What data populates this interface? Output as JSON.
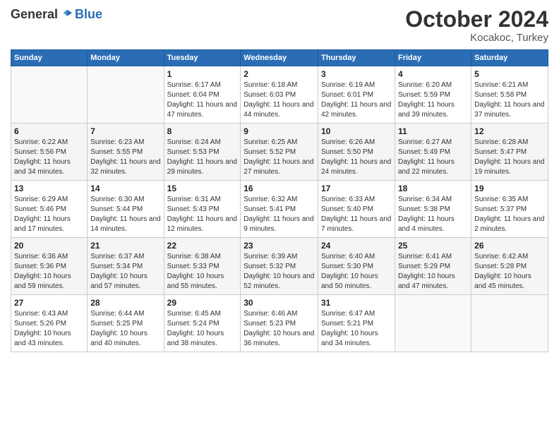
{
  "header": {
    "logo_general": "General",
    "logo_blue": "Blue",
    "title": "October 2024",
    "location": "Kocakoc, Turkey"
  },
  "weekdays": [
    "Sunday",
    "Monday",
    "Tuesday",
    "Wednesday",
    "Thursday",
    "Friday",
    "Saturday"
  ],
  "weeks": [
    [
      {
        "day": "",
        "info": ""
      },
      {
        "day": "",
        "info": ""
      },
      {
        "day": "1",
        "info": "Sunrise: 6:17 AM\nSunset: 6:04 PM\nDaylight: 11 hours and 47 minutes."
      },
      {
        "day": "2",
        "info": "Sunrise: 6:18 AM\nSunset: 6:03 PM\nDaylight: 11 hours and 44 minutes."
      },
      {
        "day": "3",
        "info": "Sunrise: 6:19 AM\nSunset: 6:01 PM\nDaylight: 11 hours and 42 minutes."
      },
      {
        "day": "4",
        "info": "Sunrise: 6:20 AM\nSunset: 5:59 PM\nDaylight: 11 hours and 39 minutes."
      },
      {
        "day": "5",
        "info": "Sunrise: 6:21 AM\nSunset: 5:58 PM\nDaylight: 11 hours and 37 minutes."
      }
    ],
    [
      {
        "day": "6",
        "info": "Sunrise: 6:22 AM\nSunset: 5:56 PM\nDaylight: 11 hours and 34 minutes."
      },
      {
        "day": "7",
        "info": "Sunrise: 6:23 AM\nSunset: 5:55 PM\nDaylight: 11 hours and 32 minutes."
      },
      {
        "day": "8",
        "info": "Sunrise: 6:24 AM\nSunset: 5:53 PM\nDaylight: 11 hours and 29 minutes."
      },
      {
        "day": "9",
        "info": "Sunrise: 6:25 AM\nSunset: 5:52 PM\nDaylight: 11 hours and 27 minutes."
      },
      {
        "day": "10",
        "info": "Sunrise: 6:26 AM\nSunset: 5:50 PM\nDaylight: 11 hours and 24 minutes."
      },
      {
        "day": "11",
        "info": "Sunrise: 6:27 AM\nSunset: 5:49 PM\nDaylight: 11 hours and 22 minutes."
      },
      {
        "day": "12",
        "info": "Sunrise: 6:28 AM\nSunset: 5:47 PM\nDaylight: 11 hours and 19 minutes."
      }
    ],
    [
      {
        "day": "13",
        "info": "Sunrise: 6:29 AM\nSunset: 5:46 PM\nDaylight: 11 hours and 17 minutes."
      },
      {
        "day": "14",
        "info": "Sunrise: 6:30 AM\nSunset: 5:44 PM\nDaylight: 11 hours and 14 minutes."
      },
      {
        "day": "15",
        "info": "Sunrise: 6:31 AM\nSunset: 5:43 PM\nDaylight: 11 hours and 12 minutes."
      },
      {
        "day": "16",
        "info": "Sunrise: 6:32 AM\nSunset: 5:41 PM\nDaylight: 11 hours and 9 minutes."
      },
      {
        "day": "17",
        "info": "Sunrise: 6:33 AM\nSunset: 5:40 PM\nDaylight: 11 hours and 7 minutes."
      },
      {
        "day": "18",
        "info": "Sunrise: 6:34 AM\nSunset: 5:38 PM\nDaylight: 11 hours and 4 minutes."
      },
      {
        "day": "19",
        "info": "Sunrise: 6:35 AM\nSunset: 5:37 PM\nDaylight: 11 hours and 2 minutes."
      }
    ],
    [
      {
        "day": "20",
        "info": "Sunrise: 6:36 AM\nSunset: 5:36 PM\nDaylight: 10 hours and 59 minutes."
      },
      {
        "day": "21",
        "info": "Sunrise: 6:37 AM\nSunset: 5:34 PM\nDaylight: 10 hours and 57 minutes."
      },
      {
        "day": "22",
        "info": "Sunrise: 6:38 AM\nSunset: 5:33 PM\nDaylight: 10 hours and 55 minutes."
      },
      {
        "day": "23",
        "info": "Sunrise: 6:39 AM\nSunset: 5:32 PM\nDaylight: 10 hours and 52 minutes."
      },
      {
        "day": "24",
        "info": "Sunrise: 6:40 AM\nSunset: 5:30 PM\nDaylight: 10 hours and 50 minutes."
      },
      {
        "day": "25",
        "info": "Sunrise: 6:41 AM\nSunset: 5:29 PM\nDaylight: 10 hours and 47 minutes."
      },
      {
        "day": "26",
        "info": "Sunrise: 6:42 AM\nSunset: 5:28 PM\nDaylight: 10 hours and 45 minutes."
      }
    ],
    [
      {
        "day": "27",
        "info": "Sunrise: 6:43 AM\nSunset: 5:26 PM\nDaylight: 10 hours and 43 minutes."
      },
      {
        "day": "28",
        "info": "Sunrise: 6:44 AM\nSunset: 5:25 PM\nDaylight: 10 hours and 40 minutes."
      },
      {
        "day": "29",
        "info": "Sunrise: 6:45 AM\nSunset: 5:24 PM\nDaylight: 10 hours and 38 minutes."
      },
      {
        "day": "30",
        "info": "Sunrise: 6:46 AM\nSunset: 5:23 PM\nDaylight: 10 hours and 36 minutes."
      },
      {
        "day": "31",
        "info": "Sunrise: 6:47 AM\nSunset: 5:21 PM\nDaylight: 10 hours and 34 minutes."
      },
      {
        "day": "",
        "info": ""
      },
      {
        "day": "",
        "info": ""
      }
    ]
  ]
}
